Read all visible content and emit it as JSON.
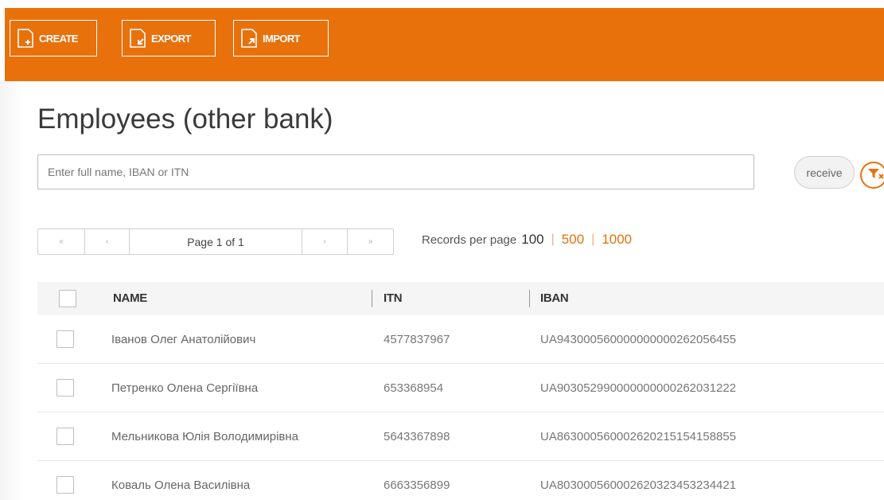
{
  "toolbar": {
    "create_label": "CREATE",
    "export_label": "EXPORT",
    "import_label": "IMPORT",
    "background_color": "#e8710c"
  },
  "page": {
    "title": "Employees (other bank)"
  },
  "search": {
    "placeholder": "Enter full name, IBAN or ITN",
    "value": ""
  },
  "actions": {
    "receive_label": "receive",
    "filter_icon": "filter-clear-icon"
  },
  "pager": {
    "first": "«",
    "prev": "‹",
    "info": "Page 1 of 1",
    "next": "›",
    "last": "»"
  },
  "records_per_page": {
    "label": "Records per page",
    "options": [
      "100",
      "500",
      "1000"
    ],
    "selected": "100"
  },
  "table": {
    "headers": {
      "name": "NAME",
      "itn": "ITN",
      "iban": "IBAN"
    },
    "rows": [
      {
        "name": "Іванов Олег Анатолійович",
        "itn": "4577837967",
        "iban": "UA943000560000000000262056455"
      },
      {
        "name": "Петренко Олена Сергіївна",
        "itn": "653368954",
        "iban": "UA903052990000000000262031222"
      },
      {
        "name": "Мельникова Юлія Володимирівна",
        "itn": "5643367898",
        "iban": "UA863000560002620215154158855"
      },
      {
        "name": "Коваль Олена Василівна",
        "itn": "6663356899",
        "iban": "UA803000560002620323453234421"
      }
    ]
  }
}
